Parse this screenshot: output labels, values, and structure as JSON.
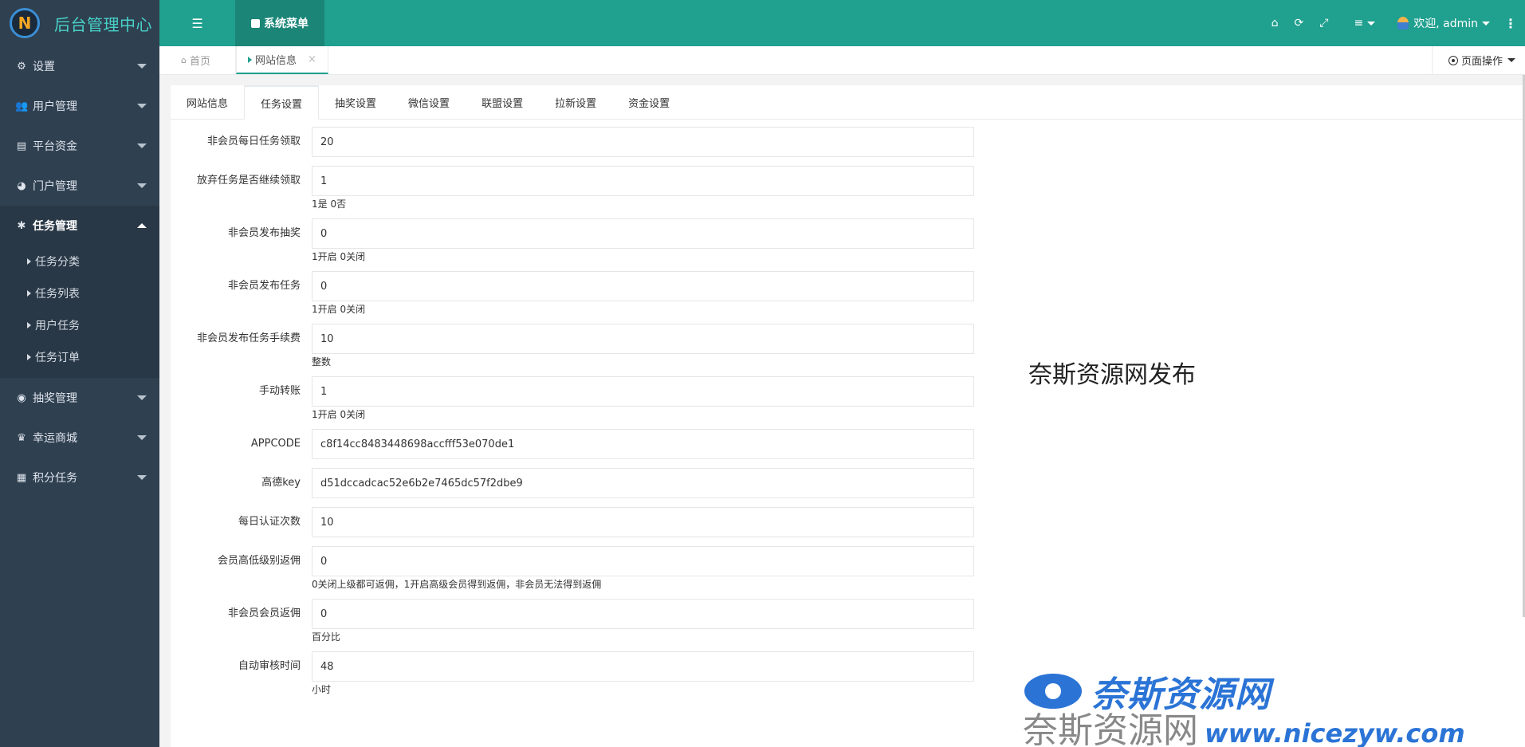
{
  "brand": {
    "logo_letter": "N",
    "title": "后台管理中心"
  },
  "sidebar": {
    "items": [
      {
        "label": "设置",
        "icon": "cogs-icon",
        "expanded": false
      },
      {
        "label": "用户管理",
        "icon": "users-icon",
        "expanded": false
      },
      {
        "label": "平台资金",
        "icon": "bank-icon",
        "expanded": false
      },
      {
        "label": "门户管理",
        "icon": "globe-icon",
        "expanded": false
      },
      {
        "label": "任务管理",
        "icon": "bug-icon",
        "expanded": true,
        "children": [
          "任务分类",
          "任务列表",
          "用户任务",
          "任务订单"
        ]
      },
      {
        "label": "抽奖管理",
        "icon": "compass-icon",
        "expanded": false
      },
      {
        "label": "幸运商城",
        "icon": "trophy-icon",
        "expanded": false
      },
      {
        "label": "积分任务",
        "icon": "grid-icon",
        "expanded": false
      }
    ]
  },
  "topbar": {
    "menu_button": "系统菜单",
    "user_greeting": "欢迎, admin",
    "icons": [
      "home-icon",
      "refresh-icon",
      "fullscreen-icon",
      "list-icon"
    ]
  },
  "tabstrip": {
    "home_tab": "首页",
    "active_tab": "网站信息",
    "close_glyph": "×",
    "page_ops": "页面操作"
  },
  "content_tabs": [
    "网站信息",
    "任务设置",
    "抽奖设置",
    "微信设置",
    "联盟设置",
    "拉新设置",
    "资金设置"
  ],
  "active_content_tab": "任务设置",
  "form": {
    "fields": [
      {
        "label": "非会员每日任务领取",
        "value": "20",
        "help": ""
      },
      {
        "label": "放弃任务是否继续领取",
        "value": "1",
        "help": "1是 0否"
      },
      {
        "label": "非会员发布抽奖",
        "value": "0",
        "help": "1开启 0关闭"
      },
      {
        "label": "非会员发布任务",
        "value": "0",
        "help": "1开启 0关闭"
      },
      {
        "label": "非会员发布任务手续费",
        "value": "10",
        "help": "整数"
      },
      {
        "label": "手动转账",
        "value": "1",
        "help": "1开启 0关闭"
      },
      {
        "label": "APPCODE",
        "value": "c8f14cc8483448698accfff53e070de1",
        "help": ""
      },
      {
        "label": "高德key",
        "value": "d51dccadcac52e6b2e7465dc57f2dbe9",
        "help": ""
      },
      {
        "label": "每日认证次数",
        "value": "10",
        "help": ""
      },
      {
        "label": "会员高低级别返佣",
        "value": "0",
        "help": "0关闭上级都可返佣，1开启高级会员得到返佣，非会员无法得到返佣"
      },
      {
        "label": "非会员会员返佣",
        "value": "0",
        "help": "百分比"
      },
      {
        "label": "自动审核时间",
        "value": "48",
        "help": "小时"
      }
    ]
  },
  "watermarks": {
    "main": "奈斯资源网发布",
    "logo_text": "奈斯资源网",
    "url_cn": "奈斯资源网",
    "url": "www.nicezyw.com"
  },
  "colors": {
    "sidebar_bg": "#2f4050",
    "topbar_bg": "#20a08f",
    "accent": "#20a08f",
    "watermark_blue": "#2b74d6"
  }
}
